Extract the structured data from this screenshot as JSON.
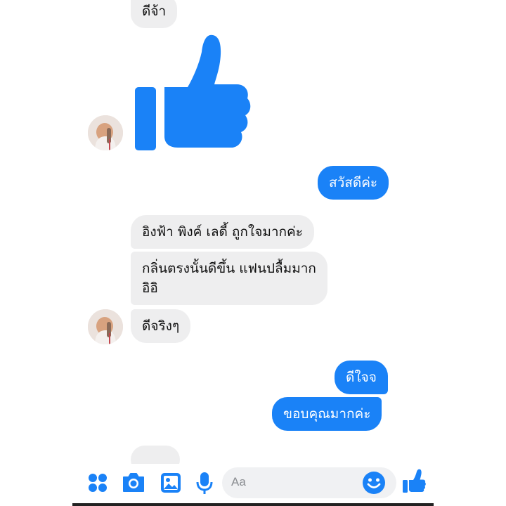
{
  "messages": [
    {
      "text": "ดีจ้า"
    },
    {
      "text": "สวัสดีค่ะ"
    },
    {
      "text": "อิงฟ้า พิงค์ เลดี้ ถูกใจมากค่ะ"
    },
    {
      "text_line1": "กลิ่นตรงนั้นดีขึ้น แฟนปลื้มมาก",
      "text_line2": "อิอิ"
    },
    {
      "text": "ดีจริงๆ"
    },
    {
      "text": "ดีใจจ"
    },
    {
      "text": "ขอบคุณมากค่ะ"
    }
  ],
  "composer": {
    "placeholder": "Aa"
  },
  "colors": {
    "accent": "#1a82f7",
    "incoming": "#eeeeef"
  },
  "icons": [
    "menu-dots-icon",
    "camera-icon",
    "gallery-icon",
    "microphone-icon",
    "emoji-icon",
    "thumbs-up-icon"
  ]
}
